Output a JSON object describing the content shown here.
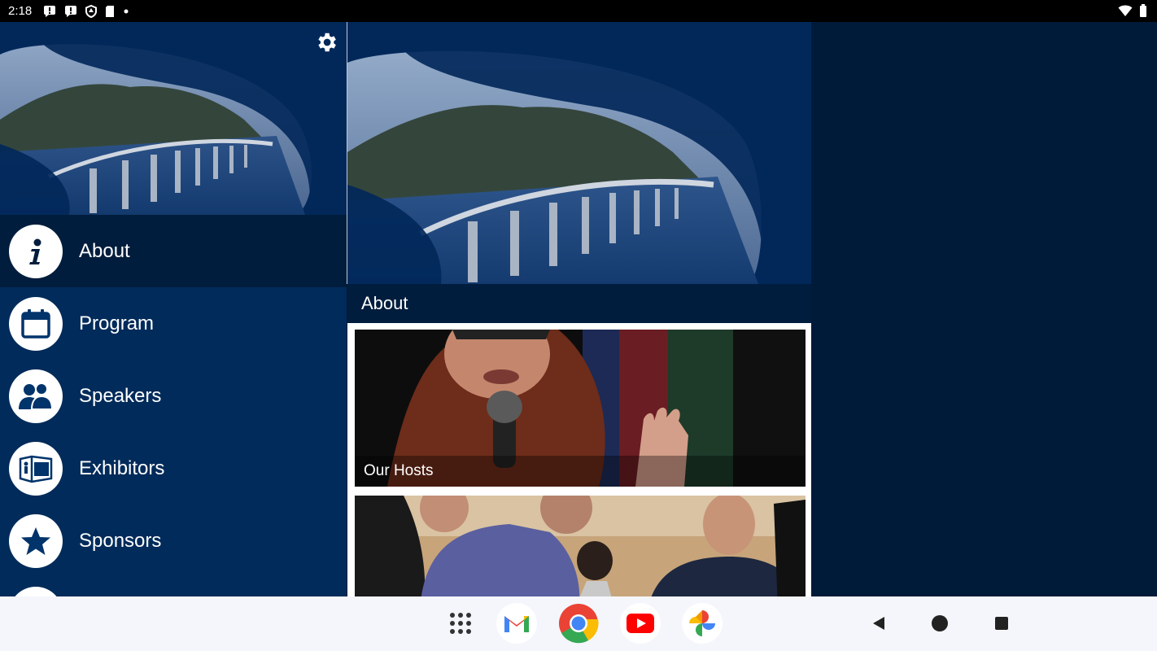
{
  "status_bar": {
    "time": "2:18"
  },
  "sidebar": {
    "items": [
      {
        "label": "About",
        "icon": "info-icon",
        "active": true
      },
      {
        "label": "Program",
        "icon": "calendar-icon",
        "active": false
      },
      {
        "label": "Speakers",
        "icon": "people-icon",
        "active": false
      },
      {
        "label": "Exhibitors",
        "icon": "booth-icon",
        "active": false
      },
      {
        "label": "Sponsors",
        "icon": "star-icon",
        "active": false
      }
    ]
  },
  "main": {
    "section_title": "About",
    "cards": [
      {
        "caption": "Our Hosts"
      },
      {
        "caption": ""
      }
    ]
  },
  "taskbar": {
    "apps": [
      "app-drawer-icon",
      "gmail-icon",
      "chrome-icon",
      "youtube-icon",
      "photos-icon"
    ]
  },
  "colors": {
    "sidebar_bg": "#012b5a",
    "active_bg": "#001d3d",
    "page_bg": "#001a3a",
    "taskbar_bg": "#f4f6fb"
  }
}
